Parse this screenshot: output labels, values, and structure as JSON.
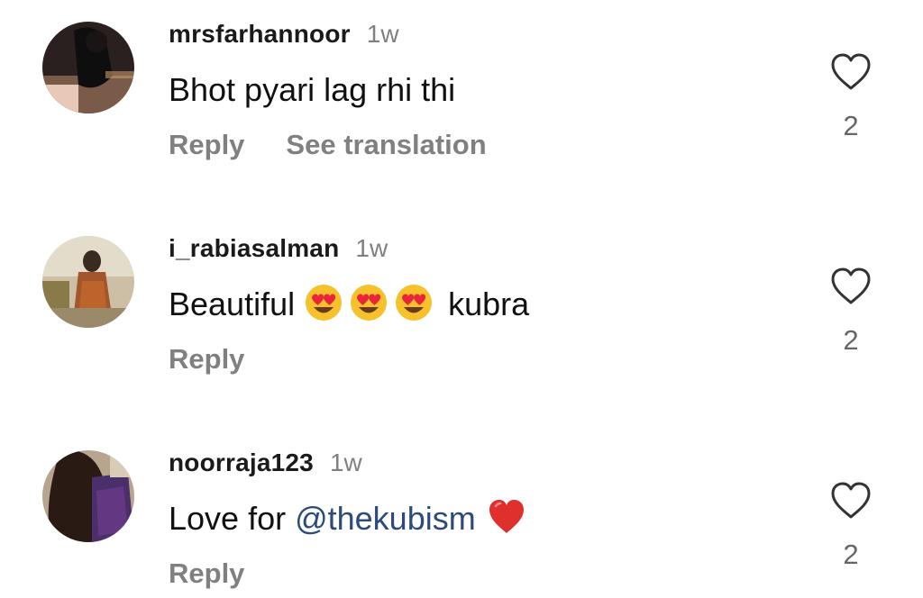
{
  "comments": [
    {
      "username": "mrsfarhannoor",
      "time": "1w",
      "text": "Bhot pyari lag rhi thi",
      "reply_label": "Reply",
      "translation_label": "See translation",
      "likes": "2"
    },
    {
      "username": "i_rabiasalman",
      "time": "1w",
      "text_before": "Beautiful ",
      "emojis": [
        "heart-eyes-emoji",
        "heart-eyes-emoji",
        "heart-eyes-emoji"
      ],
      "text_after": " kubra",
      "reply_label": "Reply",
      "likes": "2"
    },
    {
      "username": "noorraja123",
      "time": "1w",
      "text_before": "Love for ",
      "mention": "@thekubism",
      "heart_emoji": "red-heart-emoji",
      "reply_label": "Reply",
      "likes": "2"
    }
  ],
  "colors": {
    "timestamp": "#808080",
    "action": "#808080",
    "mention": "#2c4a7a",
    "heart_emoji": "#e0302e"
  },
  "icons": {
    "like": "heart-outline-icon"
  }
}
